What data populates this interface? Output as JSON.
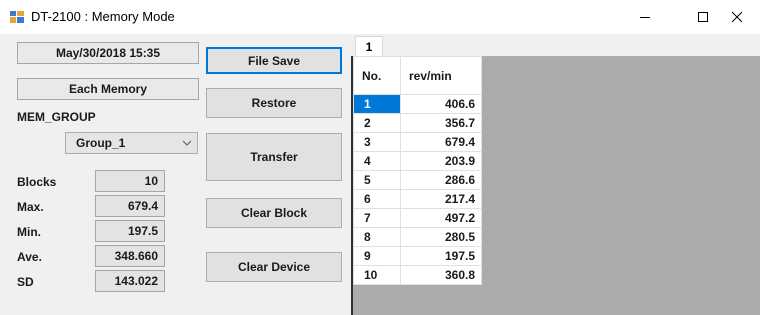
{
  "window": {
    "title": "DT-2100 : Memory Mode",
    "icon": "app-window-icon",
    "controls": {
      "minimize": "minimize-icon",
      "maximize": "maximize-icon",
      "close": "close-icon"
    }
  },
  "left_panel": {
    "datetime": "May/30/2018 15:35",
    "mode": "Each Memory",
    "mem_group_label": "MEM_GROUP",
    "group_select": {
      "value": "Group_1"
    },
    "stats": [
      {
        "label": "Blocks",
        "value": "10"
      },
      {
        "label": "Max.",
        "value": "679.4"
      },
      {
        "label": "Min.",
        "value": "197.5"
      },
      {
        "label": "Ave.",
        "value": "348.660"
      },
      {
        "label": "SD",
        "value": "143.022"
      }
    ]
  },
  "buttons": {
    "file_save": "File Save",
    "restore": "Restore",
    "transfer": "Transfer",
    "clear_block": "Clear Block",
    "clear_device": "Clear Device"
  },
  "tabs": [
    {
      "label": "1"
    }
  ],
  "table": {
    "headers": [
      "No.",
      "rev/min"
    ],
    "rows": [
      [
        "1",
        "406.6"
      ],
      [
        "2",
        "356.7"
      ],
      [
        "3",
        "679.4"
      ],
      [
        "4",
        "203.9"
      ],
      [
        "5",
        "286.6"
      ],
      [
        "6",
        "217.4"
      ],
      [
        "7",
        "497.2"
      ],
      [
        "8",
        "280.5"
      ],
      [
        "9",
        "197.5"
      ],
      [
        "10",
        "360.8"
      ]
    ],
    "selected_row": 0
  },
  "colors": {
    "accent": "#0078d7",
    "grid_bg": "#ababab",
    "window_bg": "#f0f0f0"
  }
}
